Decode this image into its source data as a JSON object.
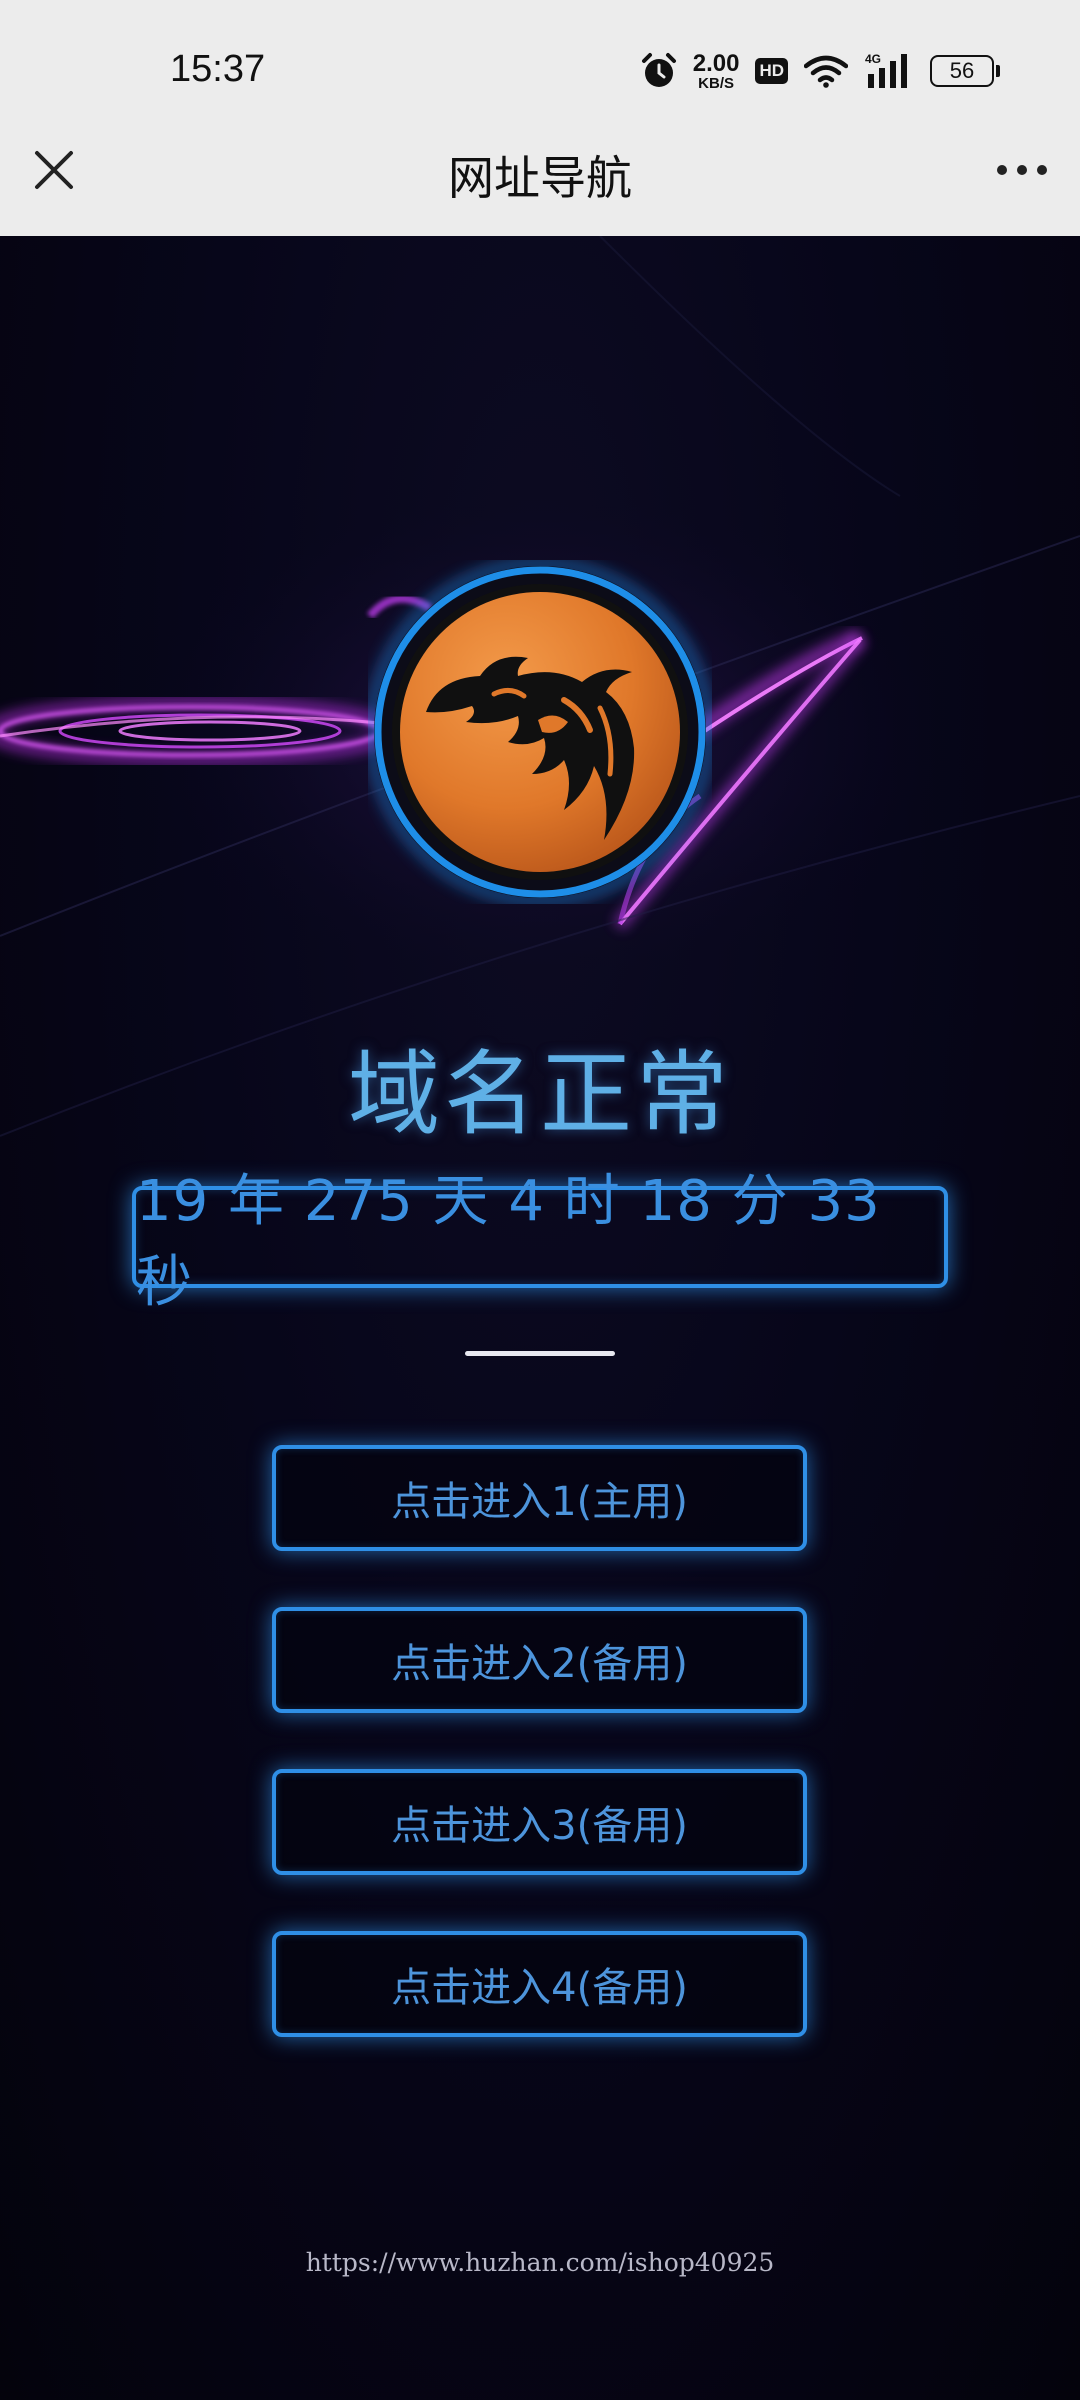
{
  "status_bar": {
    "time": "15:37",
    "net_speed_value": "2.00",
    "net_speed_unit": "KB/S",
    "hd_label": "HD",
    "network_type": "4G",
    "battery_level": "56",
    "icons": [
      "alarm-icon",
      "wifi-icon",
      "cellular-signal-icon",
      "battery-icon"
    ]
  },
  "nav": {
    "title": "网址导航",
    "close_icon": "close-icon",
    "more_icon": "more-icon"
  },
  "status": {
    "headline": "域名正常",
    "counter": "19 年 275 天 4 时 18 分 33 秒"
  },
  "entries": [
    {
      "label": "点击进入1(主用)"
    },
    {
      "label": "点击进入2(备用)"
    },
    {
      "label": "点击进入3(备用)"
    },
    {
      "label": "点击进入4(备用)"
    }
  ],
  "footer": {
    "url": "https://www.huzhan.com/ishop40925"
  },
  "colors": {
    "accent": "#2f8fe6",
    "headline": "#5fb0e6",
    "logo_orange": "#e07a2c",
    "logo_ring": "#1e8ee8",
    "glow_magenta": "#d63cff",
    "background": "#06050f"
  }
}
